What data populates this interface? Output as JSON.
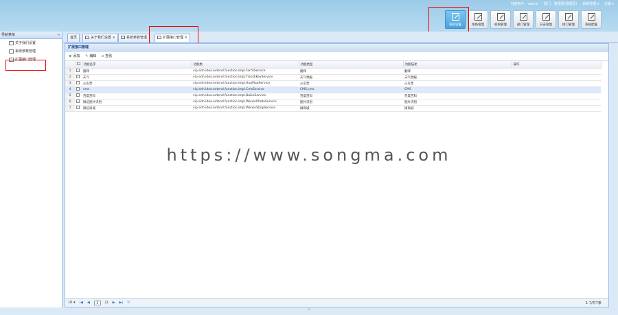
{
  "header": {
    "status": [
      "当前用户：admin",
      "部门：管理员(管理员)",
      "系统管理 ▾",
      "注销 ▾"
    ],
    "tools": [
      {
        "label": "系统设置",
        "active": true
      },
      {
        "label": "角色管理"
      },
      {
        "label": "权限管理"
      },
      {
        "label": "部门管理"
      },
      {
        "label": "日志管理"
      },
      {
        "label": "接口管理"
      },
      {
        "label": "系统配置"
      }
    ]
  },
  "sidebar": {
    "title": "导航菜单",
    "collapse": "«",
    "items": [
      {
        "label": "关于我们设置"
      },
      {
        "label": "系统参数管理"
      },
      {
        "label": "扩展接口管理"
      }
    ]
  },
  "tabs": [
    {
      "label": "首页"
    },
    {
      "label": "关于我们设置 ×"
    },
    {
      "label": "系统参数管理"
    },
    {
      "label": "扩展接口管理 ×"
    }
  ],
  "panel": {
    "title": "扩展接口管理",
    "toolbar": {
      "add": "添加",
      "edit": "编辑",
      "search": "查看"
    }
  },
  "grid": {
    "columns": [
      "功能名字",
      "功能类",
      "功能类型",
      "功能描述",
      "操作"
    ],
    "rows": [
      {
        "num": "1",
        "name": "翻译",
        "cls": "vip.edn.idea.extend.function.impl.FanYiService",
        "type": "翻译",
        "desc": "翻译"
      },
      {
        "num": "2",
        "name": "天气",
        "cls": "vip.edn.idea.extend.function.impl.TianQiKeyService",
        "type": "天气预报",
        "desc": "天气预报"
      },
      {
        "num": "3",
        "name": "火车票",
        "cls": "vip.edn.idea.extend.function.impl.HuoPiaoService",
        "type": "火车票",
        "desc": "火车票"
      },
      {
        "num": "4",
        "name": "cms",
        "cls": "vip.edn.idea.extend.function.impl.CmsService",
        "type": "CMS,cms",
        "desc": "CMS",
        "selected": true
      },
      {
        "num": "5",
        "name": "百度百科",
        "cls": "vip.edn.idea.extend.function.impl.BaikeService",
        "type": "百度百科",
        "desc": "百度百科"
      },
      {
        "num": "6",
        "name": "微信图片识别",
        "cls": "vip.edn.idea.extend.function.impl.WeixinPhotoService",
        "type": "图片识别",
        "desc": "图片识别"
      },
      {
        "num": "7",
        "name": "微信商城",
        "cls": "vip.edn.idea.extend.function.impl.WeixinShopService",
        "type": "微商城",
        "desc": "微商城"
      }
    ]
  },
  "pager": {
    "size": "10 ▾",
    "first": "|◀",
    "prev": "◀",
    "page": "1",
    "total": "/1",
    "next": "▶",
    "last": "▶|",
    "refresh": "↻",
    "info": "1-7/共7条"
  },
  "watermark": "https://www.songma.com",
  "bottom": "«"
}
